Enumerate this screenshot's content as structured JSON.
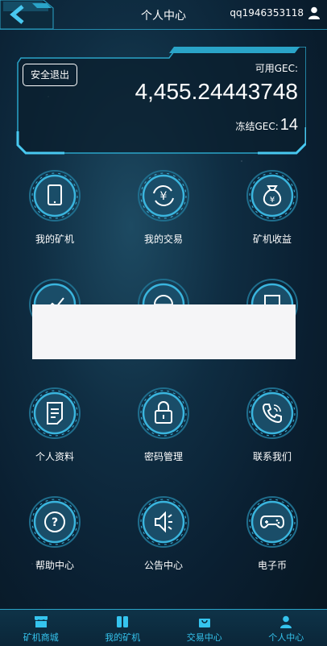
{
  "header": {
    "title": "个人中心",
    "username": "qq1946353118"
  },
  "balance": {
    "logout_label": "安全退出",
    "available_label": "可用GEC:",
    "available_value": "4,455.24443748",
    "frozen_label": "冻结GEC:",
    "frozen_value": "14"
  },
  "menu": [
    {
      "label": "我的矿机",
      "icon": "tablet-icon"
    },
    {
      "label": "我的交易",
      "icon": "yuan-refresh-icon"
    },
    {
      "label": "矿机收益",
      "icon": "money-bag-icon"
    },
    {
      "label": "",
      "icon": "trend-icon"
    },
    {
      "label": "",
      "icon": "globe-icon"
    },
    {
      "label": "",
      "icon": "recruit-icon"
    },
    {
      "label": "个人资料",
      "icon": "document-icon"
    },
    {
      "label": "密码管理",
      "icon": "lock-icon"
    },
    {
      "label": "联系我们",
      "icon": "phone-icon"
    },
    {
      "label": "帮助中心",
      "icon": "question-icon"
    },
    {
      "label": "公告中心",
      "icon": "speaker-icon"
    },
    {
      "label": "电子币",
      "icon": "gamepad-icon"
    }
  ],
  "bottom_nav": [
    {
      "label": "矿机商城",
      "icon": "shop-icon"
    },
    {
      "label": "我的矿机",
      "icon": "machine-icon"
    },
    {
      "label": "交易中心",
      "icon": "bag-icon"
    },
    {
      "label": "个人中心",
      "icon": "person-icon"
    }
  ],
  "colors": {
    "accent": "#35c4ee",
    "frame": "#2aa4c8",
    "background": "#0f2d42"
  }
}
